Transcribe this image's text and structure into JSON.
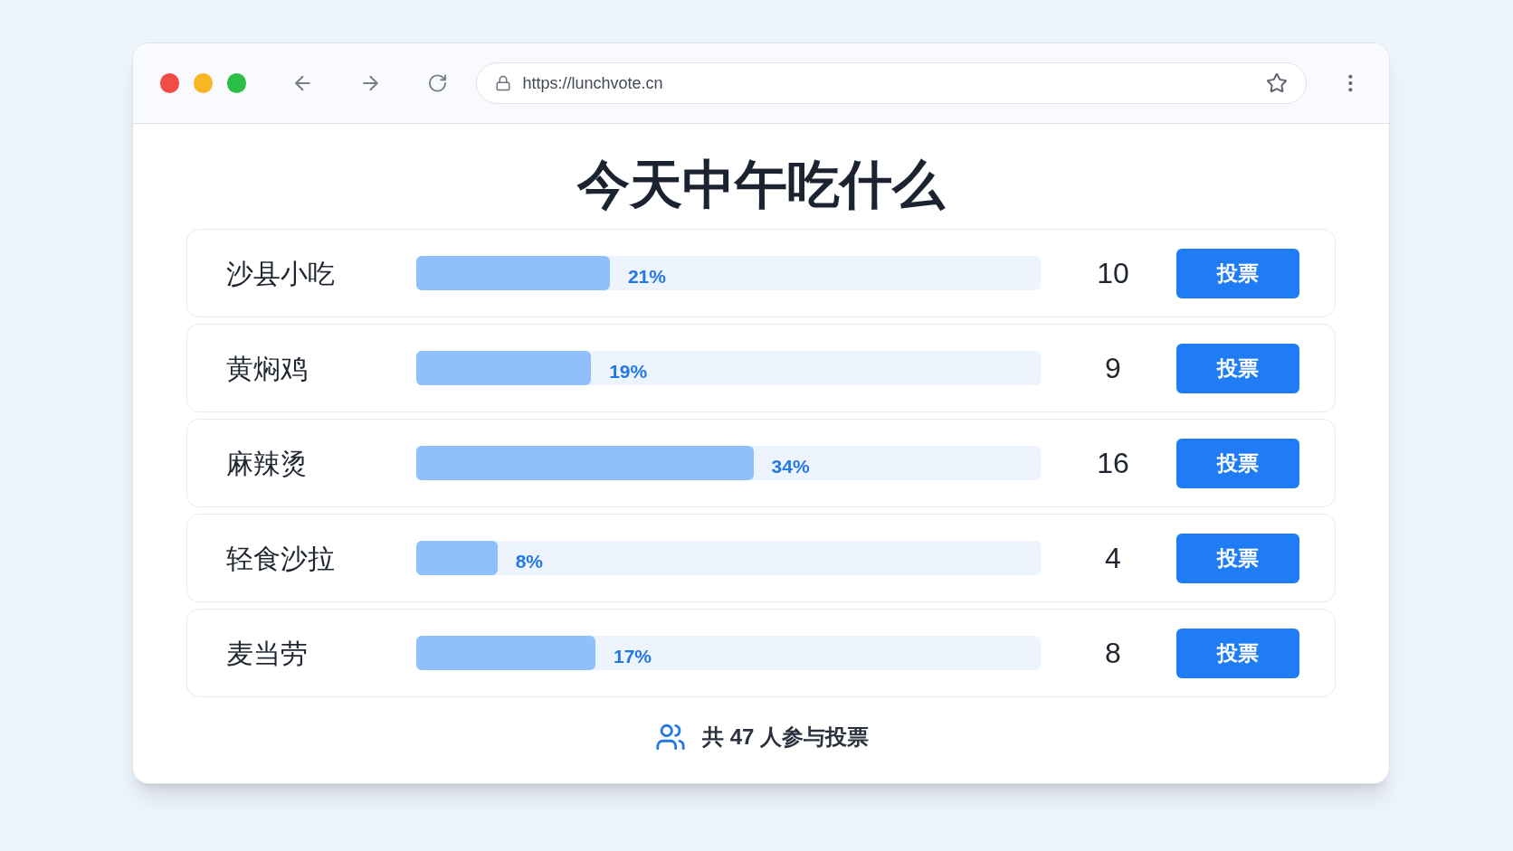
{
  "browser": {
    "url": "https://lunchvote.cn"
  },
  "title": "今天中午吃什么",
  "options": [
    {
      "name": "沙县小吃",
      "level": 0.31,
      "percent": "21%",
      "count": "10",
      "button": "投票"
    },
    {
      "name": "黄焖鸡",
      "level": 0.28,
      "percent": "19%",
      "count": "9",
      "button": "投票"
    },
    {
      "name": "麻辣烫",
      "level": 0.54,
      "percent": "34%",
      "count": "16",
      "button": "投票"
    },
    {
      "name": "轻食沙拉",
      "level": 0.13,
      "percent": "8%",
      "count": "4",
      "button": "投票"
    },
    {
      "name": "麦当劳",
      "level": 0.287,
      "percent": "17%",
      "count": "8",
      "button": "投票"
    }
  ],
  "footer": "共 47 人参与投票"
}
